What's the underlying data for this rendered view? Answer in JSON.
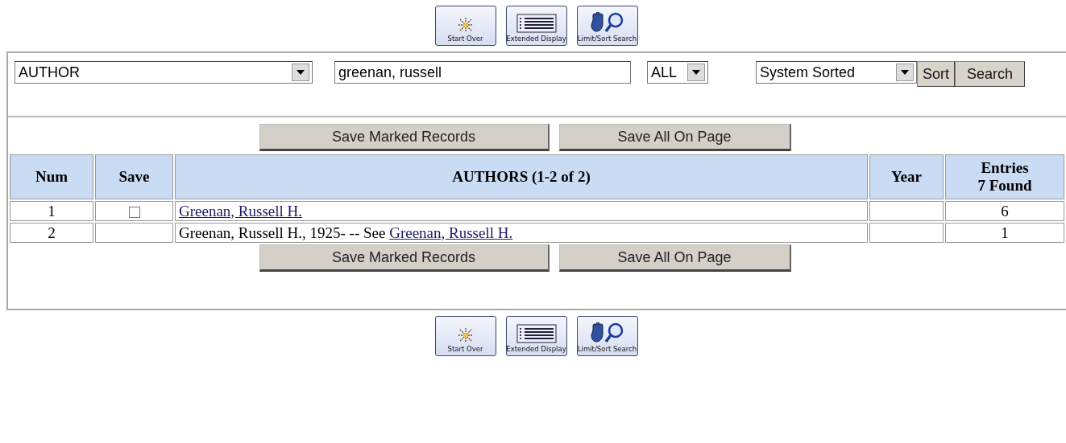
{
  "toolbar_top": [
    {
      "kind": "start-over",
      "label": "Start Over"
    },
    {
      "kind": "extended-display",
      "label": "Extended Display"
    },
    {
      "kind": "limit-sort",
      "label": "Limit/Sort Search"
    }
  ],
  "search": {
    "index": "AUTHOR",
    "query": "greenan, russell",
    "scope": "ALL",
    "sort_order": "System Sorted",
    "buttons": [
      "Sort",
      "Search"
    ]
  },
  "save_buttons_top": [
    "Save Marked Records",
    "Save All On Page"
  ],
  "table": {
    "columns": [
      "Num",
      "Save",
      "AUTHORS (1-2 of 2)",
      "Year",
      "Entries\n7 Found"
    ],
    "rows": [
      {
        "num": "1",
        "save": {
          "checked": false
        },
        "author": {
          "link": "Greenan, Russell H."
        },
        "entries": "6"
      },
      {
        "num": "2",
        "author": {
          "text": "Greenan, Russell H., 1925- -- See",
          "link": "Greenan, Russell H."
        },
        "entries": "1"
      }
    ]
  },
  "save_buttons_bottom": [
    "Save Marked Records",
    "Save All On Page"
  ],
  "toolbar_bottom": [
    {
      "kind": "start-over",
      "label": "Start Over"
    },
    {
      "kind": "extended-display",
      "label": "Extended Display"
    },
    {
      "kind": "limit-sort",
      "label": "Limit/Sort Search"
    }
  ]
}
